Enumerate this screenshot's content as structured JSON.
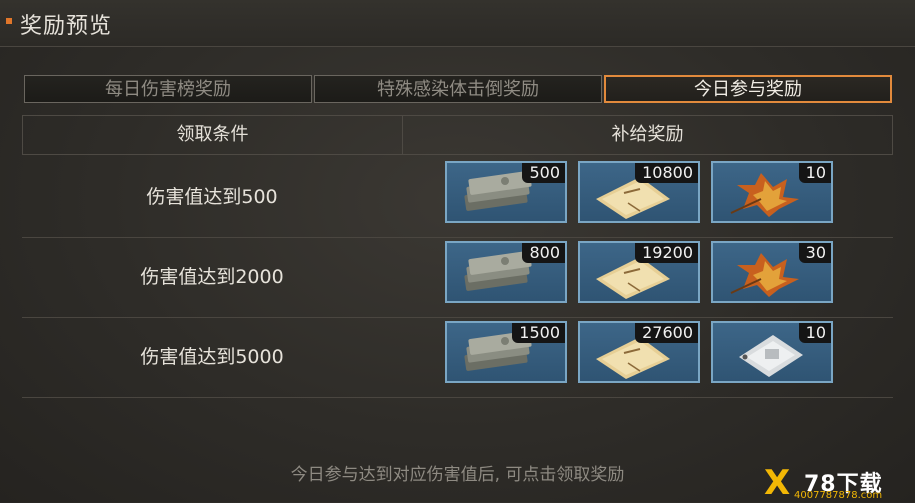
{
  "header": {
    "title": "奖励预览"
  },
  "tabs": [
    {
      "label": "每日伤害榜奖励",
      "active": false
    },
    {
      "label": "特殊感染体击倒奖励",
      "active": false
    },
    {
      "label": "今日参与奖励",
      "active": true
    }
  ],
  "table": {
    "col_condition": "领取条件",
    "col_rewards": "补给奖励",
    "rows": [
      {
        "condition": "伤害值达到500",
        "rewards": [
          {
            "icon": "cash-icon",
            "count": "500"
          },
          {
            "icon": "ticket-icon",
            "count": "10800"
          },
          {
            "icon": "leaf-icon",
            "count": "10"
          }
        ]
      },
      {
        "condition": "伤害值达到2000",
        "rewards": [
          {
            "icon": "cash-icon",
            "count": "800"
          },
          {
            "icon": "ticket-icon",
            "count": "19200"
          },
          {
            "icon": "leaf-icon",
            "count": "30"
          }
        ]
      },
      {
        "condition": "伤害值达到5000",
        "rewards": [
          {
            "icon": "cash-icon",
            "count": "1500"
          },
          {
            "icon": "ticket-icon",
            "count": "27600"
          },
          {
            "icon": "pack-icon",
            "count": "10"
          }
        ]
      }
    ]
  },
  "footer": {
    "hint": "今日参与达到对应伤害值后, 可点击领取奖励"
  },
  "watermark": {
    "brand": "78下载",
    "site": "4007787878.com",
    "mark": "X"
  },
  "colors": {
    "accent": "#e28a3c",
    "item_border": "#7aa6c4",
    "item_bg": "#2f5473"
  }
}
